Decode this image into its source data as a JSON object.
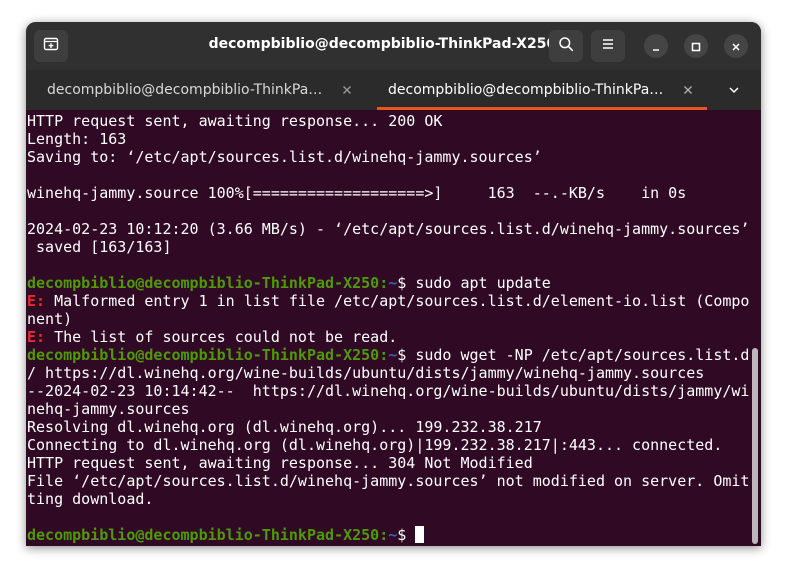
{
  "window": {
    "title": "decompbiblio@decompbiblio-ThinkPad-X250: ~"
  },
  "tabs": [
    {
      "label": "decompbiblio@decompbiblio-ThinkPa…",
      "active": false
    },
    {
      "label": "decompbiblio@decompbiblio-ThinkPa…",
      "active": true
    }
  ],
  "icons": {
    "new_tab": "new-tab-icon",
    "search": "search-icon",
    "menu": "hamburger-menu-icon",
    "minimize": "minimize-icon",
    "maximize": "maximize-icon",
    "close": "close-icon",
    "tab_close": "close-icon",
    "tab_menu": "chevron-down-icon"
  },
  "colors": {
    "terminal_bg": "#300a24",
    "prompt_user": "#4e9a06",
    "prompt_path": "#3465a4",
    "error": "#ef2929",
    "tab_accent": "#e95420"
  },
  "terminal": {
    "lines": [
      {
        "type": "text",
        "text": "HTTP request sent, awaiting response... 200 OK"
      },
      {
        "type": "text",
        "text": "Length: 163"
      },
      {
        "type": "text",
        "text": "Saving to: ‘/etc/apt/sources.list.d/winehq-jammy.sources’"
      },
      {
        "type": "text",
        "text": ""
      },
      {
        "type": "text",
        "text": "winehq-jammy.source 100%[===================>]     163  --.-KB/s    in 0s"
      },
      {
        "type": "text",
        "text": ""
      },
      {
        "type": "text",
        "text": "2024-02-23 10:12:20 (3.66 MB/s) - ‘/etc/apt/sources.list.d/winehq-jammy.sources’"
      },
      {
        "type": "text",
        "text": " saved [163/163]"
      },
      {
        "type": "text",
        "text": ""
      },
      {
        "type": "prompt",
        "user": "decompbiblio@decompbiblio-ThinkPad-X250",
        "path": "~",
        "symbol": "$",
        "command": " sudo apt update"
      },
      {
        "type": "error",
        "label": "E:",
        "text": " Malformed entry 1 in list file /etc/apt/sources.list.d/element-io.list (Compo"
      },
      {
        "type": "text",
        "text": "nent)"
      },
      {
        "type": "error",
        "label": "E:",
        "text": " The list of sources could not be read."
      },
      {
        "type": "prompt",
        "user": "decompbiblio@decompbiblio-ThinkPad-X250",
        "path": "~",
        "symbol": "$",
        "command": " sudo wget -NP /etc/apt/sources.list.d"
      },
      {
        "type": "text",
        "text": "/ https://dl.winehq.org/wine-builds/ubuntu/dists/jammy/winehq-jammy.sources"
      },
      {
        "type": "text",
        "text": "--2024-02-23 10:14:42--  https://dl.winehq.org/wine-builds/ubuntu/dists/jammy/wi"
      },
      {
        "type": "text",
        "text": "nehq-jammy.sources"
      },
      {
        "type": "text",
        "text": "Resolving dl.winehq.org (dl.winehq.org)... 199.232.38.217"
      },
      {
        "type": "text",
        "text": "Connecting to dl.winehq.org (dl.winehq.org)|199.232.38.217|:443... connected."
      },
      {
        "type": "text",
        "text": "HTTP request sent, awaiting response... 304 Not Modified"
      },
      {
        "type": "text",
        "text": "File ‘/etc/apt/sources.list.d/winehq-jammy.sources’ not modified on server. Omit"
      },
      {
        "type": "text",
        "text": "ting download."
      },
      {
        "type": "text",
        "text": ""
      },
      {
        "type": "prompt",
        "user": "decompbiblio@decompbiblio-ThinkPad-X250",
        "path": "~",
        "symbol": "$",
        "command": " ",
        "cursor": true
      }
    ]
  }
}
